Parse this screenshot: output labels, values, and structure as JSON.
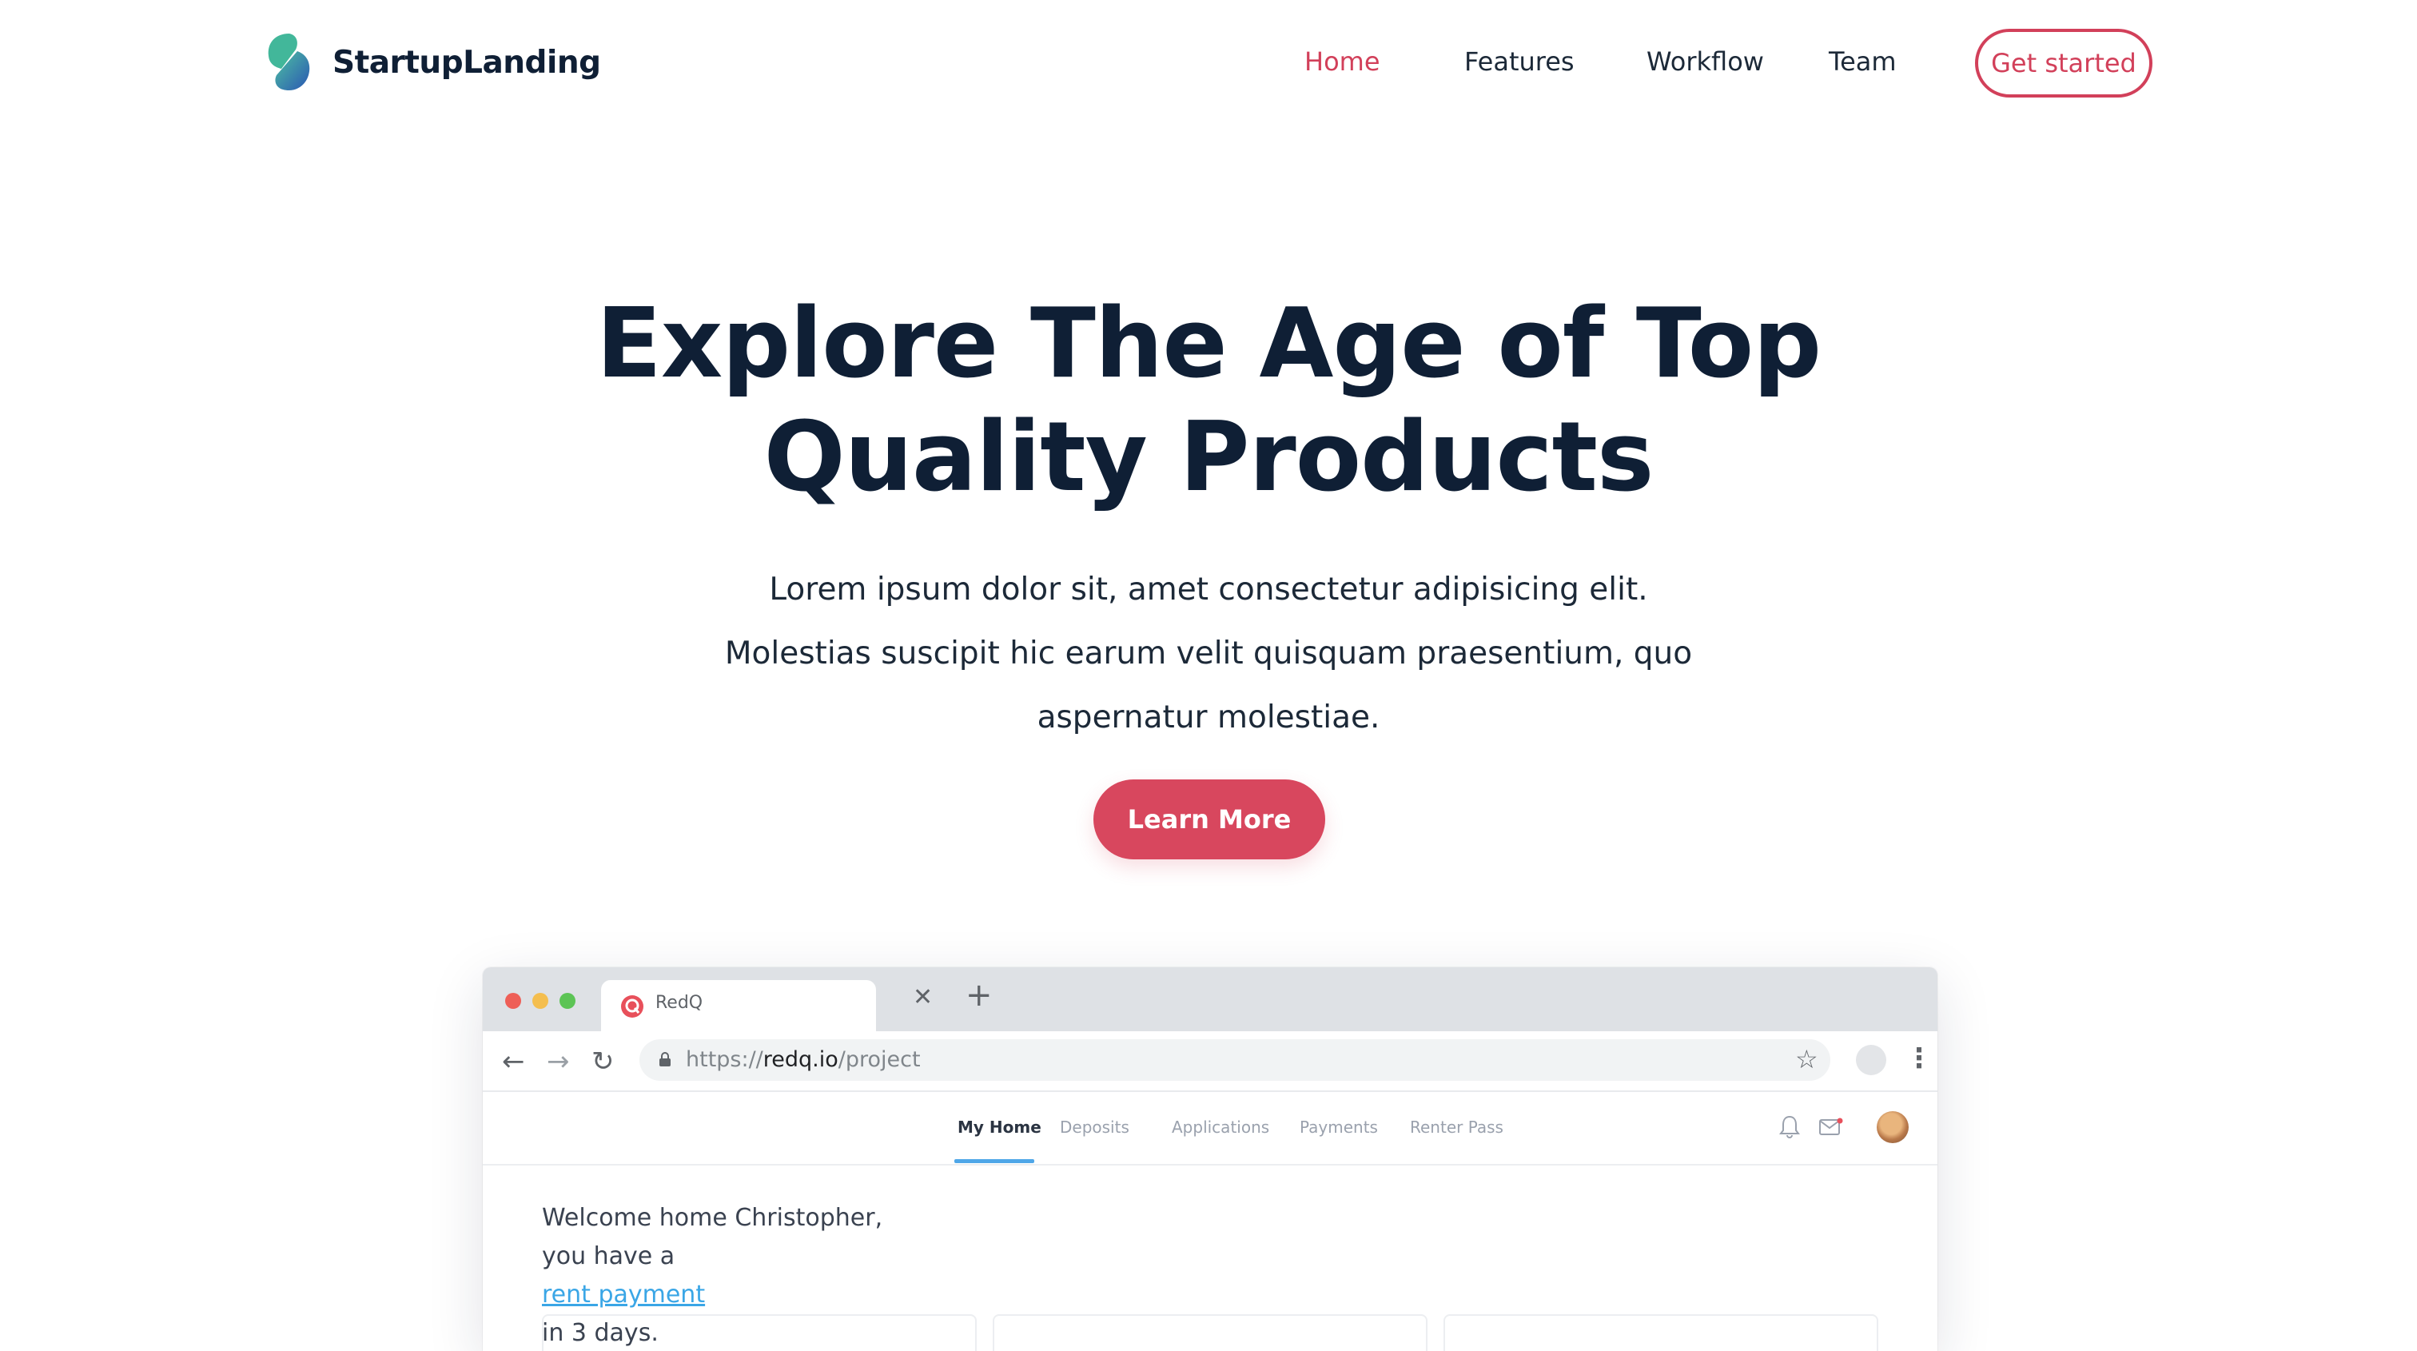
{
  "brand": {
    "name": "StartupLanding",
    "colors": {
      "accent": "#d8475e",
      "dark": "#0f1f35",
      "logo_teal": "#3db39e",
      "logo_blue": "#2f5fb8"
    }
  },
  "nav": {
    "items": [
      {
        "label": "Home",
        "active": true
      },
      {
        "label": "Features",
        "active": false
      },
      {
        "label": "Workflow",
        "active": false
      },
      {
        "label": "Team",
        "active": false
      }
    ],
    "cta_label": "Get started"
  },
  "hero": {
    "title_lines": [
      "Explore The Age of Top",
      "Quality Products"
    ],
    "text_lines": [
      "Lorem ipsum dolor sit, amet consectetur adipisicing elit.",
      "Molestias suscipit hic earum velit quisquam praesentium, quo",
      "aspernatur molestiae."
    ],
    "button_label": "Learn More"
  },
  "mockup": {
    "tab_title": "RedQ",
    "url": {
      "scheme": "https://",
      "host": "redq.io",
      "path": "/project"
    },
    "app_nav": [
      {
        "label": "My Home",
        "active": true
      },
      {
        "label": "Deposits",
        "active": false
      },
      {
        "label": "Applications",
        "active": false
      },
      {
        "label": "Payments",
        "active": false
      },
      {
        "label": "Renter Pass",
        "active": false
      }
    ],
    "welcome": {
      "line1": "Welcome home Christopher,",
      "prefix": "you have a ",
      "link": "rent payment",
      "suffix": " in 3 days."
    }
  }
}
